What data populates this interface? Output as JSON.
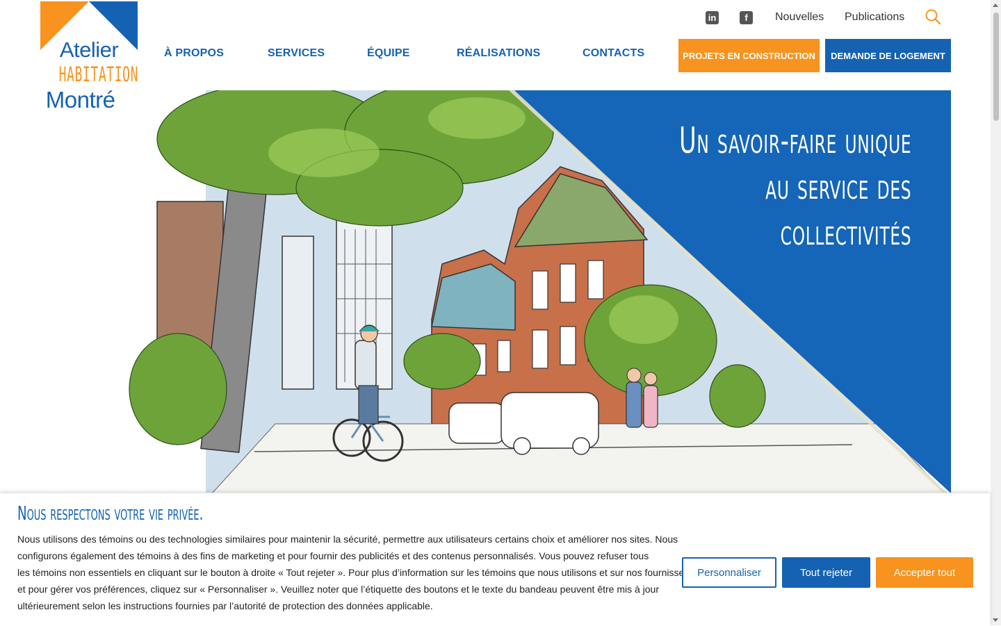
{
  "brand": {
    "line1": "Atelier",
    "line2": "HABITATION",
    "line3": "Montréal",
    "colors": {
      "orange": "#f7931e",
      "blue": "#1562b3"
    }
  },
  "utility_nav": {
    "linkedin_icon": "linkedin-icon",
    "facebook_icon": "facebook-icon",
    "links": [
      "Nouvelles",
      "Publications"
    ],
    "search_icon": "search-icon"
  },
  "main_nav": {
    "items": [
      "À PROPOS",
      "SERVICES",
      "ÉQUIPE",
      "RÉALISATIONS",
      "CONTACTS"
    ],
    "cta_projects": "PROJETS EN CONSTRUCTION",
    "cta_housing": "DEMANDE DE LOGEMENT"
  },
  "hero": {
    "title_lines": [
      "Un savoir-faire unique",
      "au service des",
      "collectivités"
    ]
  },
  "cookie_banner": {
    "title": "Nous respectons votre vie privée.",
    "text_lines": [
      "Nous utilisons des témoins ou des technologies similaires pour maintenir la sécurité, permettre aux utilisateurs certains choix et améliorer nos sites. Nous",
      "configurons également des témoins à des fins de marketing et pour fournir des publicités et des contenus personnalisés. Vous pouvez refuser tous",
      "les témoins non essentiels en cliquant sur le bouton à droite « Tout rejeter ». Pour plus d’information sur les témoins que nous utilisons et sur nos fournisseurs,",
      "et pour gérer vos préférences, cliquez sur « Personnaliser ». Veuillez noter que l’étiquette des boutons et le texte du bandeau peuvent être mis à jour",
      "ultérieurement selon les instructions fournies par l’autorité de protection des données applicable."
    ],
    "btn_customize": "Personnaliser",
    "btn_reject": "Tout rejeter",
    "btn_accept": "Accepter tout"
  }
}
